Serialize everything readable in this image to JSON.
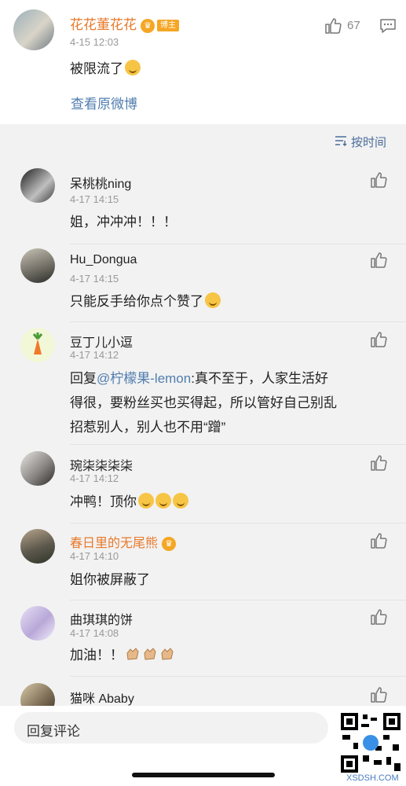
{
  "main_post": {
    "author": "花花董花花",
    "badge_label": "博主",
    "time": "4-15 12:03",
    "text": "被限流了",
    "like_count": "67",
    "view_original": "查看原微博"
  },
  "sort": {
    "label": "按时间"
  },
  "comments": [
    {
      "name": "呆桃桃ning",
      "time": "4-17 14:15",
      "text": "姐，冲冲冲！！！"
    },
    {
      "name": "Hu_Dongua",
      "time": "4-17 14:15",
      "text": "只能反手给你点个赞了"
    },
    {
      "name": "豆丁儿小逗",
      "time": "4-17 14:12",
      "prefix": "回复",
      "mention": "@柠檬果-lemon",
      "line1_rest": ":真不至于，人家生活好",
      "line2": "得很，要粉丝买也买得起，所以管好自己别乱",
      "line3": "招惹别人，别人也不用“蹭”"
    },
    {
      "name": "琬柒柒柒柒",
      "time": "4-17 14:12",
      "text": "冲鸭！顶你"
    },
    {
      "name": "春日里的无尾熊",
      "time": "4-17 14:10",
      "text": "姐你被屏蔽了"
    },
    {
      "name": "曲琪琪的饼",
      "time": "4-17 14:08",
      "text": "加油！！"
    },
    {
      "name": "猫咪 Ababy",
      "time": "",
      "text": ""
    }
  ],
  "input": {
    "placeholder": "回复评论"
  },
  "watermark": "XSDSH.COM",
  "colors": {
    "accent_link": "#507daf",
    "vip_name": "#e8792b",
    "badge": "#f5a623",
    "background": "#f2f2f2"
  }
}
